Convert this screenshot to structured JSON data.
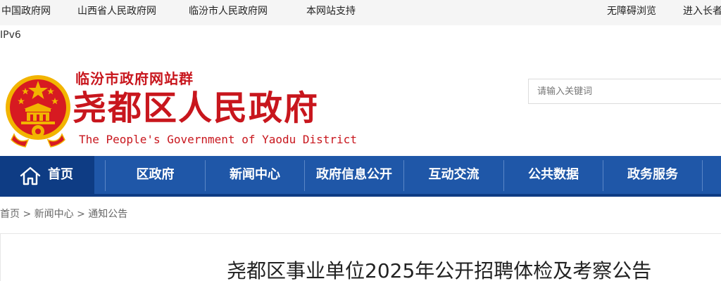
{
  "topbar": {
    "links": [
      "中国政府网",
      "山西省人民政府网",
      "临汾市人民政府网",
      "本网站支持"
    ],
    "accessible": "无障碍浏览",
    "elder": "进入长者"
  },
  "ipv6": "IPv6",
  "header": {
    "site_group": "临汾市政府网站群",
    "site_name": "尧都区人民政府",
    "site_name_en": "The People's Government of Yaodu District"
  },
  "search": {
    "placeholder": "请输入关键词"
  },
  "nav": {
    "items": [
      "首页",
      "区政府",
      "新闻中心",
      "政府信息公开",
      "互动交流",
      "公共数据",
      "政务服务"
    ],
    "active_index": 0
  },
  "breadcrumb": {
    "items": [
      "首页",
      "新闻中心",
      "通知公告"
    ],
    "separator": ">"
  },
  "article": {
    "title": "尧都区事业单位2025年公开招聘体检及考察公告"
  },
  "colors": {
    "brand_red": "#c8161d",
    "nav_blue": "#1f57a8",
    "nav_active": "#0e3c84",
    "emblem_gold": "#f2b400"
  }
}
